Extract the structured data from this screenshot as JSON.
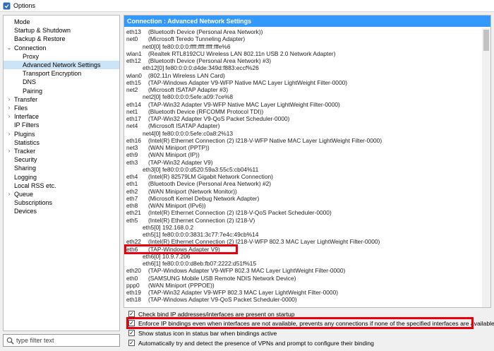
{
  "window": {
    "title": "Options"
  },
  "sidebar": {
    "items": [
      {
        "label": "Mode",
        "level": 0,
        "expander": ""
      },
      {
        "label": "Startup & Shutdown",
        "level": 0,
        "expander": ""
      },
      {
        "label": "Backup & Restore",
        "level": 0,
        "expander": ""
      },
      {
        "label": "Connection",
        "level": 0,
        "expander": "⌄"
      },
      {
        "label": "Proxy",
        "level": 1,
        "expander": ""
      },
      {
        "label": "Advanced Network Settings",
        "level": 1,
        "expander": "",
        "selected": true
      },
      {
        "label": "Transport Encryption",
        "level": 1,
        "expander": ""
      },
      {
        "label": "DNS",
        "level": 1,
        "expander": ""
      },
      {
        "label": "Pairing",
        "level": 1,
        "expander": ""
      },
      {
        "label": "Transfer",
        "level": 0,
        "expander": "›"
      },
      {
        "label": "Files",
        "level": 0,
        "expander": "›"
      },
      {
        "label": "Interface",
        "level": 0,
        "expander": "›"
      },
      {
        "label": "IP Filters",
        "level": 0,
        "expander": ""
      },
      {
        "label": "Plugins",
        "level": 0,
        "expander": "›"
      },
      {
        "label": "Statistics",
        "level": 0,
        "expander": ""
      },
      {
        "label": "Tracker",
        "level": 0,
        "expander": "›"
      },
      {
        "label": "Security",
        "level": 0,
        "expander": ""
      },
      {
        "label": "Sharing",
        "level": 0,
        "expander": ""
      },
      {
        "label": "Logging",
        "level": 0,
        "expander": ""
      },
      {
        "label": "Local RSS etc.",
        "level": 0,
        "expander": ""
      },
      {
        "label": "Queue",
        "level": 0,
        "expander": "›"
      },
      {
        "label": "Subscriptions",
        "level": 0,
        "expander": ""
      },
      {
        "label": "Devices",
        "level": 0,
        "expander": ""
      }
    ]
  },
  "filter": {
    "value": "type filter text"
  },
  "panel": {
    "title": "Connection : Advanced Network Settings",
    "interfaces": [
      {
        "name": "eth13",
        "desc": "(Bluetooth Device (Personal Area Network))",
        "type": "iface"
      },
      {
        "name": "net0",
        "desc": "(Microsoft Teredo Tunneling Adapter)",
        "type": "iface"
      },
      {
        "name": "net0[0]",
        "desc": "fe80:0:0:0:ffff:ffff:ffff:fffe%6",
        "type": "addr"
      },
      {
        "name": "wlan1",
        "desc": "(Realtek RTL8192CU Wireless LAN 802.11n USB 2.0 Network Adapter)",
        "type": "iface"
      },
      {
        "name": "eth12",
        "desc": "(Bluetooth Device (Personal Area Network) #3)",
        "type": "iface"
      },
      {
        "name": "eth12[0]",
        "desc": "fe80:0:0:0:d4de:349d:f883:eccf%26",
        "type": "addr"
      },
      {
        "name": "wlan0",
        "desc": "(802.11n Wireless LAN Card)",
        "type": "iface"
      },
      {
        "name": "eth15",
        "desc": "(TAP-Windows Adapter V9-WFP Native MAC Layer LightWeight Filter-0000)",
        "type": "iface"
      },
      {
        "name": "net2",
        "desc": "(Microsoft ISATAP Adapter #3)",
        "type": "iface"
      },
      {
        "name": "net2[0]",
        "desc": "fe80:0:0:0:5efe:a09:7ce%8",
        "type": "addr"
      },
      {
        "name": "eth14",
        "desc": "(TAP-Win32 Adapter V9-WFP Native MAC Layer LightWeight Filter-0000)",
        "type": "iface"
      },
      {
        "name": "net1",
        "desc": "(Bluetooth Device (RFCOMM Protocol TDI))",
        "type": "iface"
      },
      {
        "name": "eth17",
        "desc": "(TAP-Win32 Adapter V9-QoS Packet Scheduler-0000)",
        "type": "iface"
      },
      {
        "name": "net4",
        "desc": "(Microsoft ISATAP Adapter)",
        "type": "iface"
      },
      {
        "name": "net4[0]",
        "desc": "fe80:0:0:0:5efe:c0a8:2%13",
        "type": "addr"
      },
      {
        "name": "eth16",
        "desc": "(Intel(R) Ethernet Connection (2) I218-V-WFP Native MAC Layer LightWeight Filter-0000)",
        "type": "iface"
      },
      {
        "name": "net3",
        "desc": "(WAN Miniport (PPTP))",
        "type": "iface"
      },
      {
        "name": "eth9",
        "desc": "(WAN Miniport (IP))",
        "type": "iface"
      },
      {
        "name": "eth3",
        "desc": "(TAP-Win32 Adapter V9)",
        "type": "iface"
      },
      {
        "name": "eth3[0]",
        "desc": "fe80:0:0:0:d520:59a3:55c5:cb04%11",
        "type": "addr"
      },
      {
        "name": "eth4",
        "desc": "(Intel(R) 82579LM Gigabit Network Connection)",
        "type": "iface"
      },
      {
        "name": "eth1",
        "desc": "(Bluetooth Device (Personal Area Network) #2)",
        "type": "iface"
      },
      {
        "name": "eth2",
        "desc": "(WAN Miniport (Network Monitor))",
        "type": "iface"
      },
      {
        "name": "eth7",
        "desc": "(Microsoft Kernel Debug Network Adapter)",
        "type": "iface"
      },
      {
        "name": "eth8",
        "desc": "(WAN Miniport (IPv6))",
        "type": "iface"
      },
      {
        "name": "eth21",
        "desc": "(Intel(R) Ethernet Connection (2) I218-V-QoS Packet Scheduler-0000)",
        "type": "iface"
      },
      {
        "name": "eth5",
        "desc": "(Intel(R) Ethernet Connection (2) I218-V)",
        "type": "iface"
      },
      {
        "name": "eth5[0]",
        "desc": "192.168.0.2",
        "type": "addr"
      },
      {
        "name": "eth5[1]",
        "desc": "fe80:0:0:0:3831:3c77:7e4c:49cb%14",
        "type": "addr"
      },
      {
        "name": "eth22",
        "desc": "(Intel(R) Ethernet Connection (2) I218-V-WFP 802.3 MAC Layer LightWeight Filter-0000)",
        "type": "iface"
      },
      {
        "name": "eth6",
        "desc": "(TAP-Windows Adapter V9)",
        "type": "iface",
        "highlight": true
      },
      {
        "name": "eth6[0]",
        "desc": "10.9.7.206",
        "type": "addr"
      },
      {
        "name": "eth6[1]",
        "desc": "fe80:0:0:0:d8eb:fb07:2222:d51f%15",
        "type": "addr"
      },
      {
        "name": "eth20",
        "desc": "(TAP-Windows Adapter V9-WFP 802.3 MAC Layer LightWeight Filter-0000)",
        "type": "iface"
      },
      {
        "name": "eth0",
        "desc": "(SAMSUNG Mobile USB Remote NDIS Network Device)",
        "type": "iface"
      },
      {
        "name": "ppp0",
        "desc": "(WAN Miniport (PPPOE))",
        "type": "iface"
      },
      {
        "name": "eth19",
        "desc": "(TAP-Win32 Adapter V9-WFP 802.3 MAC Layer LightWeight Filter-0000)",
        "type": "iface"
      },
      {
        "name": "eth18",
        "desc": "(TAP-Windows Adapter V9-QoS Packet Scheduler-0000)",
        "type": "iface"
      }
    ]
  },
  "options": [
    {
      "label": "Check bind IP addresses/interfaces are present on startup",
      "checked": true
    },
    {
      "label": "Enforce IP bindings even when interfaces are not available, prevents any connections if none of the specified interfaces are available",
      "checked": true,
      "highlight": true
    },
    {
      "label": "Show status icon in status bar when bindings active",
      "checked": true
    },
    {
      "label": "Automatically try and detect the presence of VPNs and prompt to configure their binding",
      "checked": true
    }
  ],
  "colors": {
    "accent": "#3399ff",
    "selection": "#cce4f7",
    "highlight": "#e8000d"
  },
  "icons": {
    "app": "app-icon",
    "filter": "magnifier-icon",
    "check": "✓"
  }
}
